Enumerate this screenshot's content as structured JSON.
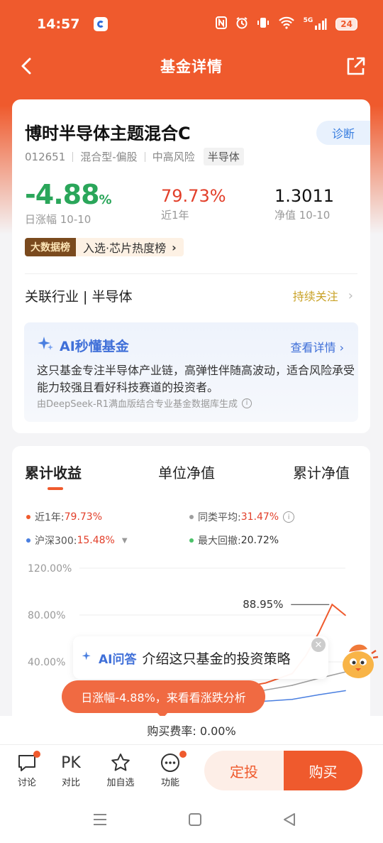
{
  "status_bar": {
    "time": "14:57",
    "network": "5G",
    "battery": "24",
    "icons": [
      "nfc-icon",
      "alarm-icon",
      "vibrate-icon",
      "wifi-icon",
      "signal-icon"
    ]
  },
  "nav": {
    "title": "基金详情"
  },
  "fund": {
    "name": "博时半导体主题混合C",
    "diagnose_label": "诊断",
    "code": "012651",
    "type": "混合型-偏股",
    "risk": "中高风险",
    "sector_tag": "半导体",
    "daily_change": "-4.88",
    "daily_change_unit": "%",
    "daily_label": "日涨幅 10-10",
    "year_return": "79.73%",
    "year_label": "近1年",
    "nav_value": "1.3011",
    "nav_label": "净值 10-10",
    "bigdata_badge": "大数据榜",
    "bigdata_text": "入选·芯片热度榜",
    "industry_text": "关联行业 | 半导体",
    "follow_label": "持续关注"
  },
  "ai_card": {
    "title": "AI秒懂基金",
    "detail_link": "查看详情",
    "description": "这只基金专注半导体产业链，高弹性伴随高波动，适合风险承受能力较强且看好科技赛道的投资者。",
    "source": "由DeepSeek-R1满血版结合专业基金数据库生成"
  },
  "chart_tabs": [
    "累计收益",
    "单位净值",
    "累计净值"
  ],
  "legend": {
    "near_year_label": "近1年:",
    "near_year_value": "79.73%",
    "peer_label": "同类平均:",
    "peer_value": "31.47%",
    "hs300_label": "沪深300:",
    "hs300_value": "15.48%",
    "drawdown_label": "最大回撤:",
    "drawdown_value": "20.72%"
  },
  "colors": {
    "brand": "#ef5a2d",
    "fund_line": "#ef5a2d",
    "peer_line": "#9e9e9e",
    "hs300_line": "#4a7fe0",
    "drawdown": "#4cc26a",
    "down": "#2aa65a",
    "up": "#e23f2a"
  },
  "chart_data": {
    "type": "line",
    "ylabels": [
      "120.00%",
      "80.00%",
      "40.00%"
    ],
    "ylim": [
      0,
      120
    ],
    "annotations": [
      "88.95%"
    ],
    "series": [
      {
        "name": "近1年",
        "x": [
          0,
          10,
          20,
          30,
          40,
          50,
          60,
          70,
          80,
          85,
          90,
          95,
          100
        ],
        "values": [
          5,
          8,
          6,
          10,
          9,
          14,
          18,
          22,
          30,
          45,
          65,
          88.95,
          79.73
        ]
      },
      {
        "name": "同类平均",
        "x": [
          0,
          20,
          40,
          60,
          80,
          90,
          100
        ],
        "values": [
          2,
          4,
          6,
          12,
          20,
          26,
          31.47
        ]
      },
      {
        "name": "沪深300",
        "x": [
          0,
          20,
          40,
          60,
          80,
          90,
          100
        ],
        "values": [
          -2,
          0,
          2,
          5,
          8,
          12,
          15.48
        ]
      }
    ]
  },
  "floating": {
    "ai_label": "AI问答",
    "ai_question": "介绍这只基金的投资策略",
    "drop_text": "日涨幅-4.88%，来看看涨跌分析"
  },
  "fee_text": "购买费率: 0.00%",
  "bottom": {
    "discuss": "讨论",
    "pk_glyph": "PK",
    "compare": "对比",
    "add_watch": "加自选",
    "functions": "功能",
    "plan": "定投",
    "buy": "购买"
  }
}
